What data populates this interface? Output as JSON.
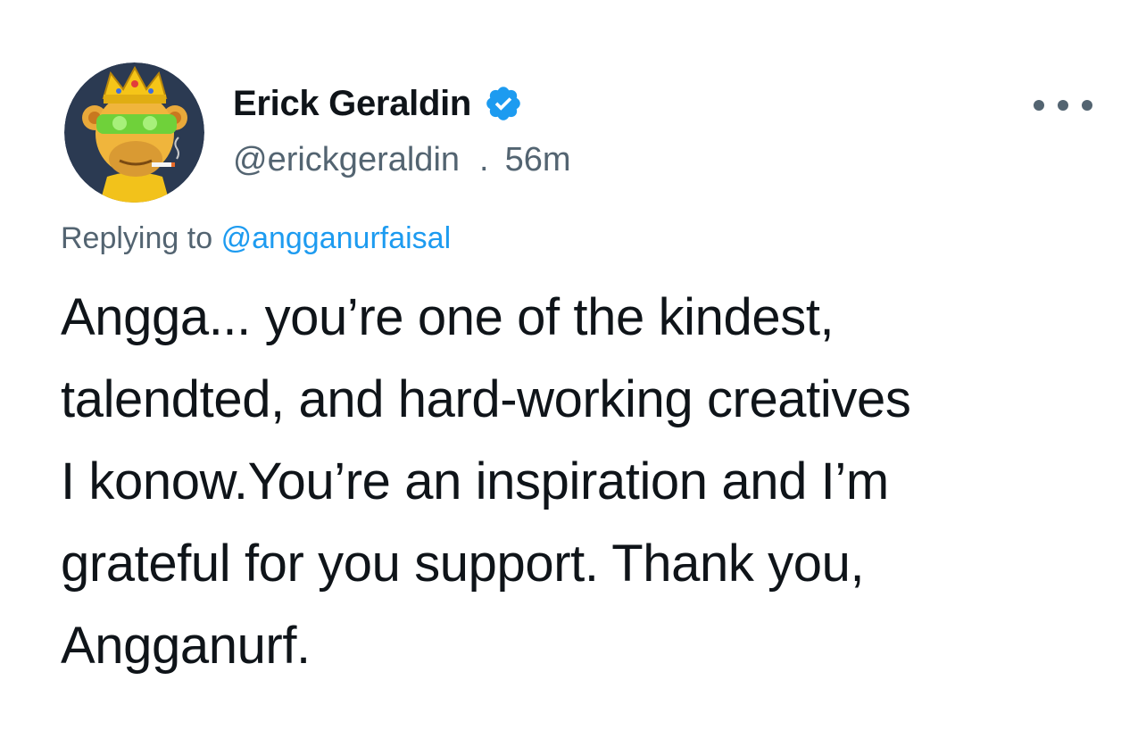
{
  "author": {
    "display_name": "Erick Geraldin",
    "handle": "@erickgeraldin",
    "separator": ".",
    "timestamp": "56m",
    "verified_icon": "verified-badge-icon",
    "avatar_icon": "crowned-ape-avatar"
  },
  "more_icon": "more-horizontal-icon",
  "reply": {
    "prefix": "Replying to",
    "target": "@angganurfaisal"
  },
  "tweet": {
    "text": "Angga... you’re one of the kindest,\ntalendted, and hard-working creatives\nI konow.You’re an inspiration and I’m\ngrateful for you support. Thank you,\nAngganurf."
  },
  "colors": {
    "accent": "#1d9bf0",
    "secondary_text": "#536471",
    "primary_text": "#0f1419",
    "avatar_background": "#2b3a52"
  }
}
